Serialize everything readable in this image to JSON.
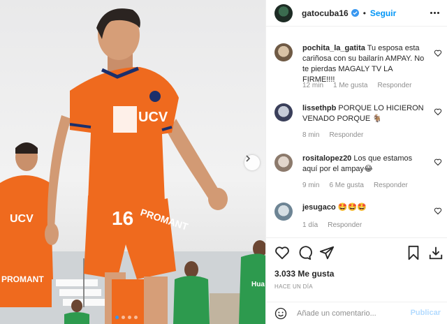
{
  "post": {
    "username": "gatocuba16",
    "verified": true,
    "separator": "•",
    "follow_label": "Seguir"
  },
  "comments": [
    {
      "username": "pochita_la_gatita",
      "text": "Tu esposa esta cariñosa con su bailarín AMPAY. No te pierdas MAGALY TV LA FIRME!!!!",
      "time": "12 min",
      "likes": "1 Me gusta",
      "reply_label": "Responder",
      "avatar_icon": "profile-photo"
    },
    {
      "username": "lissethpb",
      "text": "PORQUE LO HICIERON VENADO PORQUE 🐐",
      "time": "8 min",
      "likes": "",
      "reply_label": "Responder",
      "avatar_icon": "profile-photo"
    },
    {
      "username": "rositalopez20",
      "text": "Los que estamos aquí por el ampay😂",
      "time": "9 min",
      "likes": "6 Me gusta",
      "reply_label": "Responder",
      "avatar_icon": "profile-photo"
    },
    {
      "username": "jesugaco",
      "text": "🤩🤩🤩",
      "time": "1 día",
      "likes": "",
      "reply_label": "Responder",
      "avatar_icon": "profile-photo"
    }
  ],
  "stats": {
    "likes": "3.033 Me gusta",
    "posted": "HACE UN DÍA"
  },
  "composer": {
    "placeholder": "Añade un comentario...",
    "publish_label": "Publicar"
  },
  "media": {
    "jersey_number": "16",
    "sponsor_text": "UCV",
    "sponsor_shorts": "PROMANT",
    "carousel": {
      "count": 4,
      "active": 1
    }
  },
  "colors": {
    "accent": "#0095f6",
    "verified": "#3897f0",
    "muted": "#8e8e8e",
    "jersey_orange": "#ef6a1e"
  }
}
